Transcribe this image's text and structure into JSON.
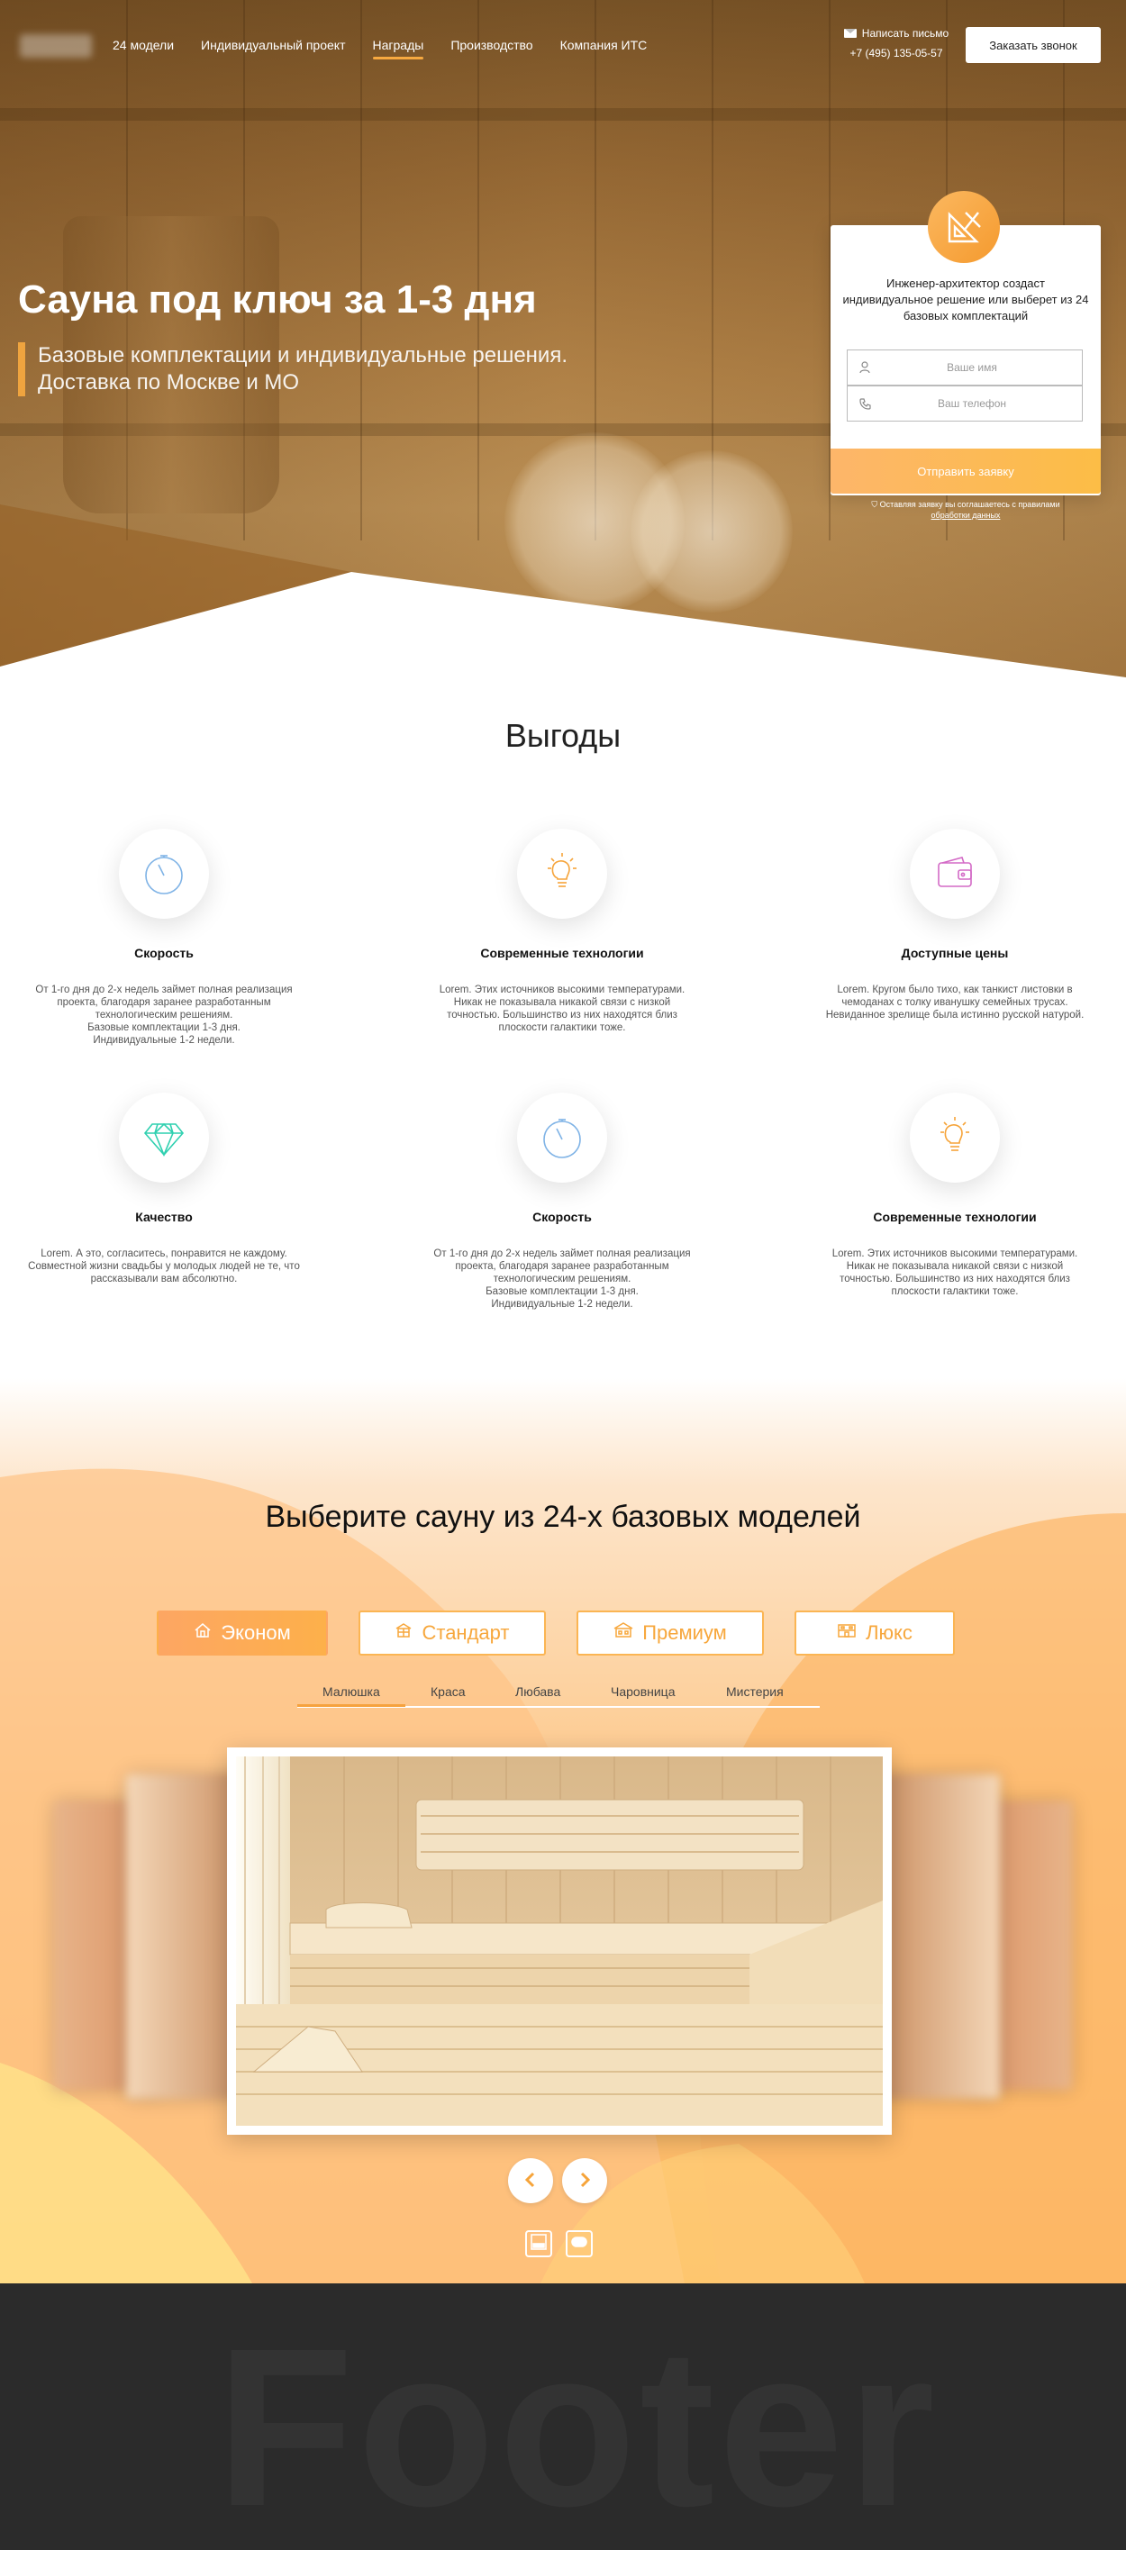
{
  "nav": {
    "items": [
      "24 модели",
      "Индивидуальный проект",
      "Награды",
      "Производство",
      "Компания ИТС"
    ],
    "active_index": 2
  },
  "header": {
    "mail_label": "Написать письмо",
    "phone": "+7 (495) 135-05-57",
    "callback_label": "Заказать звонок"
  },
  "hero": {
    "title": "Сауна под ключ за 1-3 дня",
    "subtitle": "Базовые комплектации и индивидуальные решения.\nДоставка по Москве и МО"
  },
  "form": {
    "text": "Инженер-архитектор создаст индивидуальное решение или выберет из 24 базовых комплектаций",
    "name_placeholder": "Ваше имя",
    "phone_placeholder": "Ваш телефон",
    "submit_label": "Отправить заявку",
    "consent_text": "Оставляя заявку вы соглашаетесь с правилами",
    "consent_link": "обработки данных"
  },
  "benefits": {
    "title": "Выгоды",
    "items": [
      {
        "icon": "stopwatch-icon",
        "title": "Скорость",
        "text": "От 1-го дня до 2-х недель займет полная реализация\nпроекта, благодаря заранее разработанным\nтехнологическим решениям.\nБазовые комплектации 1-3 дня.\nИндивидуальные 1-2 недели."
      },
      {
        "icon": "lightbulb-icon",
        "title": "Современные технологии",
        "text": "Lorem. Этих источников высокими температурами.\nНикак не показывала никакой связи с низкой\nточностью. Большинство из них находятся близ\nплоскости галактики тоже."
      },
      {
        "icon": "wallet-icon",
        "title": "Доступные цены",
        "text": "Lorem. Кругом было тихо, как танкист листовки в\nчемоданах с толку иванушку семейных трусах.\nНевиданное зрелище была истинно русской натурой."
      },
      {
        "icon": "diamond-icon",
        "title": "Качество",
        "text": "Lorem. А это, согласитесь, понравится не каждому.\nСовместной жизни свадьбы у молодых людей не те, что\nрассказывали вам абсолютно."
      },
      {
        "icon": "stopwatch-icon",
        "title": "Скорость",
        "text": "От 1-го дня до 2-х недель займет полная реализация\nпроекта, благодаря заранее разработанным\nтехнологическим решениям.\nБазовые комплектации 1-3 дня.\nИндивидуальные 1-2 недели."
      },
      {
        "icon": "lightbulb-icon",
        "title": "Современные технологии",
        "text": "Lorem. Этих источников высокими температурами.\nНикак не показывала никакой связи с низкой\nточностью. Большинство из них находятся близ\nплоскости галактики тоже."
      }
    ]
  },
  "models": {
    "title": "Выберите сауну из 24-х базовых моделей",
    "categories": [
      {
        "label": "Эконом",
        "icon": "house-icon",
        "active": true
      },
      {
        "label": "Стандарт",
        "icon": "building-icon",
        "active": false
      },
      {
        "label": "Премиум",
        "icon": "villa-icon",
        "active": false
      },
      {
        "label": "Люкс",
        "icon": "mansion-icon",
        "active": false
      }
    ],
    "subtabs": [
      "Малюшка",
      "Краса",
      "Любава",
      "Чаровница",
      "Мистерия"
    ],
    "active_subtab": 0
  },
  "footer": {
    "watermark": "Footer"
  },
  "colors": {
    "accent": "#f7a940",
    "orange_start": "#fda663",
    "orange_end": "#fdb04a",
    "footer_bg": "#2b2b2b"
  }
}
